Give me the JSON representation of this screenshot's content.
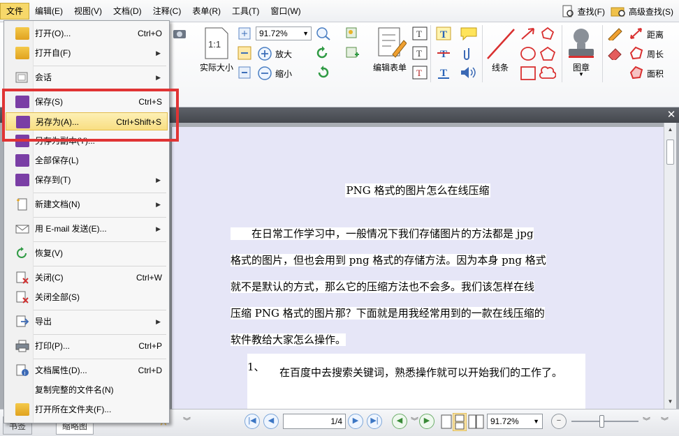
{
  "menubar": {
    "items": [
      "文件",
      "编辑(E)",
      "视图(V)",
      "文档(D)",
      "注释(C)",
      "表单(R)",
      "工具(T)",
      "窗口(W)"
    ],
    "find_label": "查找(F)",
    "advanced_find_label": "高级查找(S)"
  },
  "ribbon": {
    "zoom_value": "91.72%",
    "actual_size_label": "实际大小",
    "zoom_in_label": "放大",
    "zoom_out_label": "缩小",
    "edit_form_label": "编辑表单",
    "lines_label": "线条",
    "stamp_label": "图章",
    "distance_label": "距离",
    "perimeter_label": "周长",
    "area_label": "面积",
    "actual_size_icon_text": "1:1"
  },
  "file_menu": {
    "items": [
      {
        "label": "打开(O)...",
        "shortcut": "Ctrl+O",
        "submenu": false
      },
      {
        "label": "打开自(F)",
        "shortcut": "",
        "submenu": true
      },
      {
        "label": "会话",
        "shortcut": "",
        "submenu": true
      },
      {
        "label": "保存(S)",
        "shortcut": "Ctrl+S",
        "submenu": false
      },
      {
        "label": "另存为(A)...",
        "shortcut": "Ctrl+Shift+S",
        "submenu": false
      },
      {
        "label": "另存为副本(Y)...",
        "shortcut": "",
        "submenu": false
      },
      {
        "label": "全部保存(L)",
        "shortcut": "",
        "submenu": false
      },
      {
        "label": "保存到(T)",
        "shortcut": "",
        "submenu": true
      },
      {
        "label": "新建文档(N)",
        "shortcut": "",
        "submenu": true
      },
      {
        "label": "用 E-mail 发送(E)...",
        "shortcut": "",
        "submenu": true
      },
      {
        "label": "恢复(V)",
        "shortcut": "",
        "submenu": false
      },
      {
        "label": "关闭(C)",
        "shortcut": "Ctrl+W",
        "submenu": false
      },
      {
        "label": "关闭全部(S)",
        "shortcut": "",
        "submenu": false
      },
      {
        "label": "导出",
        "shortcut": "",
        "submenu": true
      },
      {
        "label": "打印(P)...",
        "shortcut": "Ctrl+P",
        "submenu": false
      },
      {
        "label": "文档属性(D)...",
        "shortcut": "Ctrl+D",
        "submenu": false
      },
      {
        "label": "复制完整的文件名(N)",
        "shortcut": "",
        "submenu": false
      },
      {
        "label": "打开所在文件夹(F)...",
        "shortcut": "",
        "submenu": false
      }
    ]
  },
  "document": {
    "title": "PNG 格式的图片怎么在线压缩",
    "paragraph_lines": [
      "　　在日常工作学习中，一般情况下我们存储图片的方法都是 jpg",
      "格式的图片，但也会用到 png 格式的存储方法。因为本身 png 格式",
      "就不是默认的方式，那么它的压缩方法也不会多。我们该怎样在线",
      "压缩 PNG 格式的图片那？下面就是用我经常用到的一款在线压缩的",
      "软件教给大家怎么操作。"
    ],
    "step_number": "1、",
    "step_text": "在百度中去搜索关键词，熟悉操作就可以开始我们的工作了。"
  },
  "statusbar": {
    "tab1": "书签",
    "tab2": "缩略图",
    "page_indicator": "1/4",
    "zoom_value": "91.72%"
  },
  "colors": {
    "highlight_red": "#e03434",
    "menu_highlight": "#f8de82",
    "page_bg": "#e6e6f7"
  }
}
